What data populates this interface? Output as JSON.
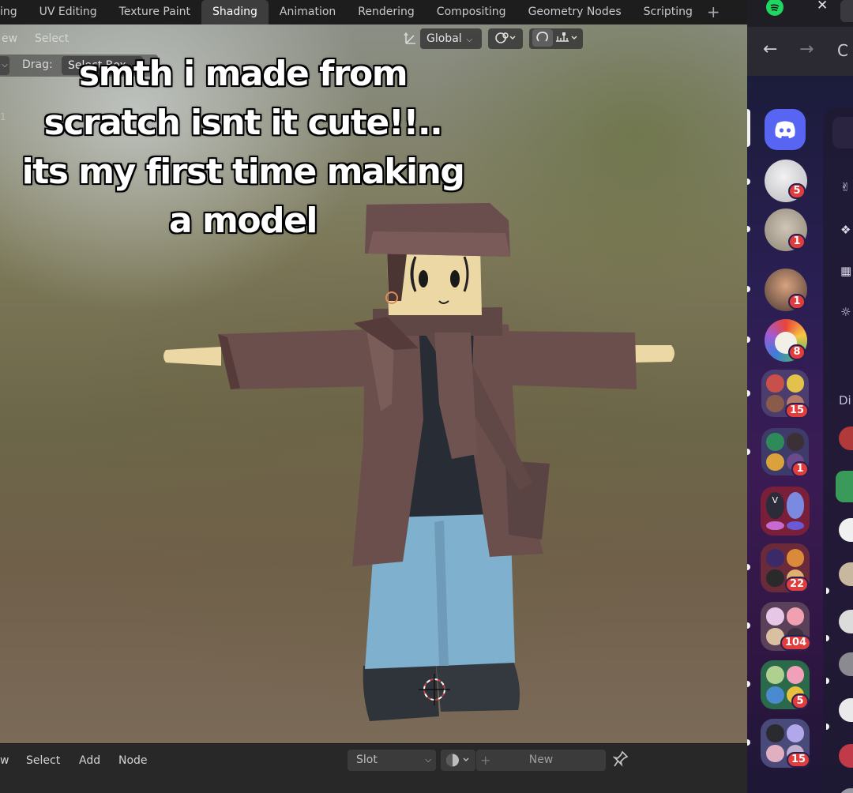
{
  "blender": {
    "workspace_tabs": [
      {
        "label": "ing",
        "active": false
      },
      {
        "label": "UV Editing",
        "active": false
      },
      {
        "label": "Texture Paint",
        "active": false
      },
      {
        "label": "Shading",
        "active": true
      },
      {
        "label": "Animation",
        "active": false
      },
      {
        "label": "Rendering",
        "active": false
      },
      {
        "label": "Compositing",
        "active": false
      },
      {
        "label": "Geometry Nodes",
        "active": false
      },
      {
        "label": "Scripting",
        "active": false
      }
    ],
    "add_workspace": "+",
    "viewport_menu": {
      "view": "ew",
      "select": "Select",
      "transform": "Global"
    },
    "drag_label": "Drag:",
    "drag_value": "Select Box",
    "side_number": "1",
    "node_menu": {
      "view": "w",
      "select": "Select",
      "add": "Add",
      "node": "Node"
    },
    "slot_label": "Slot",
    "new_label": "New",
    "new_plus": "+"
  },
  "caption": "smth i made from scratch isnt it cute!!.. its my first time making a model",
  "colors": {
    "coat": "#6b4f4d",
    "coat_dark": "#553c3b",
    "skin": "#ecd8a4",
    "jeans": "#7fb0cd",
    "shoes": "#34383f",
    "shirt": "#282c35",
    "discord_blurple": "#5865f2",
    "badge_red": "#e23d3d"
  },
  "browser": {
    "close": "✕",
    "back": "←",
    "forward": "→",
    "reload": "C"
  },
  "discord": {
    "section_label": "Di",
    "servers": [
      {
        "name": "discord-home",
        "badge": ""
      },
      {
        "name": "server-1",
        "badge": "5"
      },
      {
        "name": "server-2",
        "badge": "1"
      },
      {
        "name": "server-3",
        "badge": "1"
      },
      {
        "name": "server-4",
        "badge": "8"
      },
      {
        "name": "folder-1",
        "badge": "15"
      },
      {
        "name": "folder-2",
        "badge": "1"
      },
      {
        "name": "folder-3",
        "badge": "",
        "letter": "V"
      },
      {
        "name": "folder-4",
        "badge": "22"
      },
      {
        "name": "folder-5",
        "badge": "104"
      },
      {
        "name": "folder-6",
        "badge": "5"
      },
      {
        "name": "folder-7",
        "badge": "15"
      }
    ]
  }
}
